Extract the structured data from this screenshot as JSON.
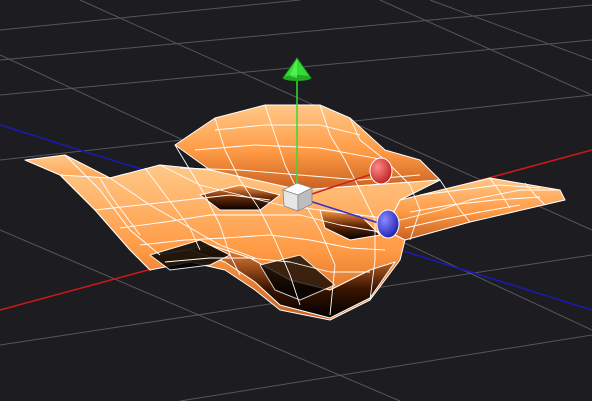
{
  "viewport": {
    "background": "#1d1d21",
    "grid_color": "#5a5a60",
    "x_axis_color": "#d01818",
    "z_axis_color": "#1a1ab8",
    "y_axis_color": "#22dd22"
  },
  "surface": {
    "type": "wireframe-heightmap",
    "wire_color": "#ffffff",
    "fill_colors": [
      "#000000",
      "#ff9a4a",
      "#ffc07a"
    ]
  },
  "gizmo": {
    "center_handle": {
      "shape": "cube",
      "color": "#f2f2f2",
      "icon": "move-all-icon"
    },
    "y_handle": {
      "shape": "cone",
      "color": "#33dd33",
      "icon": "arrow-up-icon"
    },
    "x_handle": {
      "shape": "sphere",
      "color": "#e04040",
      "icon": "circle-icon"
    },
    "z_handle": {
      "shape": "sphere",
      "color": "#4040e0",
      "icon": "circle-icon"
    }
  }
}
